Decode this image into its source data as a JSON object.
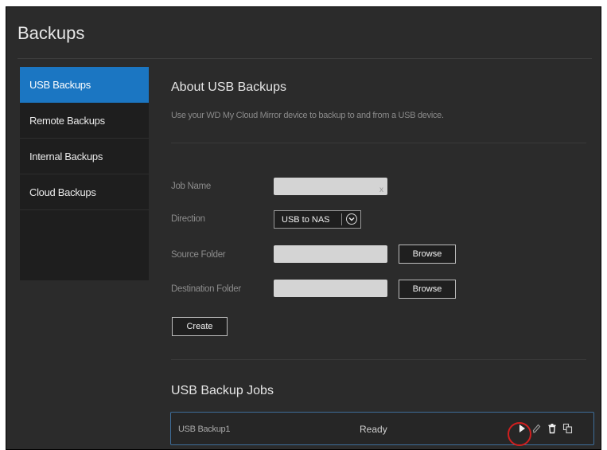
{
  "page": {
    "title": "Backups"
  },
  "sidebar": {
    "items": [
      {
        "label": "USB Backups",
        "active": true
      },
      {
        "label": "Remote Backups"
      },
      {
        "label": "Internal Backups"
      },
      {
        "label": "Cloud Backups"
      }
    ]
  },
  "about": {
    "title": "About USB Backups",
    "description": "Use your WD My Cloud Mirror device to backup to and from a USB device."
  },
  "form": {
    "job_name": {
      "label": "Job Name",
      "value": "",
      "clear_glyph": "x"
    },
    "direction": {
      "label": "Direction",
      "selected": "USB to NAS"
    },
    "source_folder": {
      "label": "Source Folder",
      "value": "",
      "browse_label": "Browse"
    },
    "destination_folder": {
      "label": "Destination Folder",
      "value": "",
      "browse_label": "Browse"
    },
    "create_label": "Create"
  },
  "jobs": {
    "title": "USB Backup Jobs",
    "rows": [
      {
        "name": "USB Backup1",
        "status": "Ready",
        "actions": [
          "play-icon",
          "edit-icon",
          "trash-icon",
          "copy-icon"
        ]
      }
    ]
  },
  "colors": {
    "accent": "#1b76c2",
    "highlight": "#d11f1f",
    "background": "#2b2b2b"
  }
}
